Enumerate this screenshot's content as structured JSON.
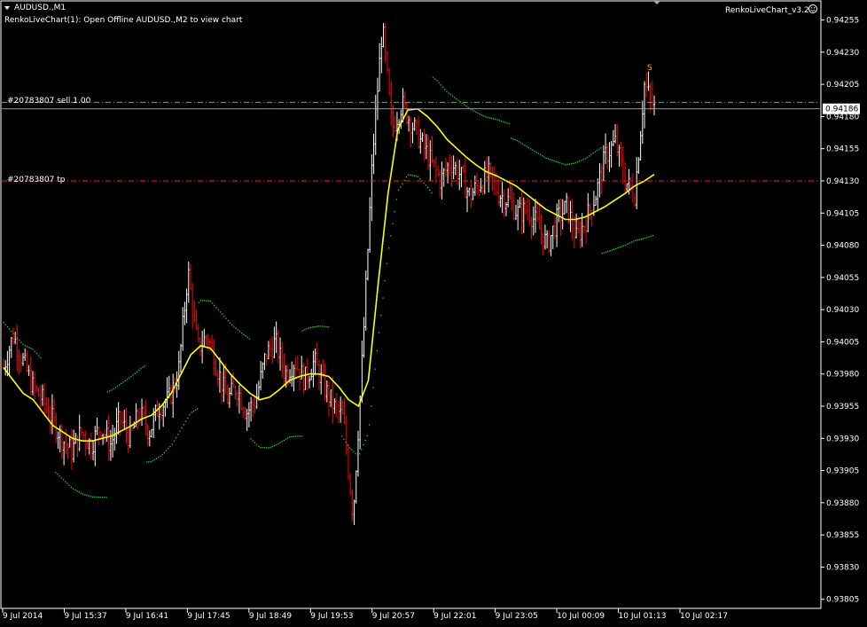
{
  "window": {
    "title": "AUDUSD.,M1",
    "indicator_name": "RenkoLiveChart_v3.2",
    "info_line": "RenkoLiveChart(1): Open Offline AUDUSD.,M2 to view chart"
  },
  "colors": {
    "background": "#000000",
    "bull_bar": "#ffffff",
    "bear_bar": "#ff0000",
    "moving_average": "#ffff00",
    "trailing_stop": "#22dd22",
    "sell_line": "#22dd22",
    "tp_line": "#ff2020",
    "signal": "#ffaa00",
    "axis": "#ffffff"
  },
  "orders": {
    "sell": {
      "label": "#20783807 sell 1.00",
      "price": 0.94191
    },
    "tp": {
      "label": "#20783807 tp",
      "price": 0.9413
    }
  },
  "current_price": {
    "label": "0.94186",
    "value": 0.94186
  },
  "signal": {
    "text": "S",
    "price": 0.94212
  },
  "chart_data": {
    "type": "line",
    "symbol": "AUDUSD.",
    "timeframe": "M1",
    "ylim": [
      0.938,
      0.94265
    ],
    "y_ticks": [
      "0.94255",
      "0.94230",
      "0.94205",
      "0.94180",
      "0.94155",
      "0.94130",
      "0.94105",
      "0.94080",
      "0.94055",
      "0.94030",
      "0.94005",
      "0.93980",
      "0.93955",
      "0.93930",
      "0.93905",
      "0.93880",
      "0.93855",
      "0.93830",
      "0.93805"
    ],
    "x_ticks": [
      "9 Jul 2014",
      "9 Jul 15:37",
      "9 Jul 16:41",
      "9 Jul 17:45",
      "9 Jul 18:49",
      "9 Jul 19:53",
      "9 Jul 20:57",
      "9 Jul 22:01",
      "9 Jul 23:05",
      "10 Jul 00:09",
      "10 Jul 01:13",
      "10 Jul 02:17"
    ],
    "series": [
      {
        "name": "",
        "values": [
          0.93985,
          0.93975,
          0.93965,
          0.9396,
          0.9395,
          0.9394,
          0.93935,
          0.9393,
          0.93928,
          0.93928,
          0.9393,
          0.93932,
          0.93936,
          0.9394,
          0.93945,
          0.93948,
          0.93955,
          0.93965,
          0.9398,
          0.93995,
          0.94002,
          0.94,
          0.9399,
          0.9398,
          0.93972,
          0.93965,
          0.9396,
          0.93962,
          0.93968,
          0.93975,
          0.93978,
          0.9398,
          0.9398,
          0.93978,
          0.9397,
          0.9396,
          0.93955,
          0.93975,
          0.9405,
          0.9412,
          0.9417,
          0.94185,
          0.94186,
          0.9418,
          0.94172,
          0.94162,
          0.94155,
          0.94148,
          0.94142,
          0.94137,
          0.94134,
          0.9413,
          0.94126,
          0.9412,
          0.94114,
          0.94108,
          0.94104,
          0.941,
          0.941,
          0.94102,
          0.94106,
          0.9411,
          0.94115,
          0.9412,
          0.94126,
          0.9413,
          0.94135
        ]
      },
      {
        "name": "",
        "values": [
          0.93985,
          0.9401,
          0.9399,
          0.9397,
          0.9396,
          0.93945,
          0.9393,
          0.9392,
          0.93935,
          0.93925,
          0.9394,
          0.93925,
          0.93945,
          0.9393,
          0.9395,
          0.93935,
          0.93955,
          0.9396,
          0.9398,
          0.9406,
          0.94,
          0.9401,
          0.93985,
          0.9396,
          0.9397,
          0.9395,
          0.9396,
          0.93995,
          0.94005,
          0.9398,
          0.9399,
          0.93975,
          0.9399,
          0.9397,
          0.93955,
          0.93945,
          0.9387,
          0.94,
          0.9415,
          0.9425,
          0.9417,
          0.9419,
          0.94175,
          0.9416,
          0.94145,
          0.9413,
          0.94145,
          0.94135,
          0.94118,
          0.94128,
          0.94135,
          0.9412,
          0.94115,
          0.94105,
          0.94108,
          0.94095,
          0.9408,
          0.941,
          0.9411,
          0.94085,
          0.941,
          0.9412,
          0.9415,
          0.9416,
          0.9413,
          0.9412,
          0.94205,
          0.94186
        ]
      }
    ]
  }
}
